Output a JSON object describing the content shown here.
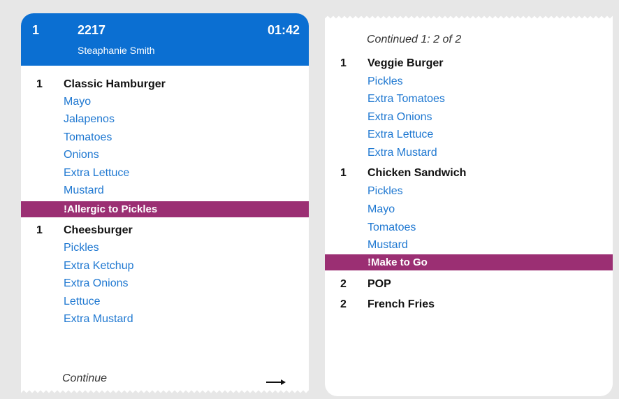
{
  "ticket_left": {
    "header": {
      "seat": "1",
      "order_number": "2217",
      "customer_name": "Steaphanie Smith",
      "timer": "01:42",
      "color": "#0b6fd2"
    },
    "items": [
      {
        "qty": "1",
        "name": "Classic Hamburger",
        "modifiers": [
          "Mayo",
          "Jalapenos",
          "Tomatoes",
          "Onions",
          "Extra Lettuce",
          "Mustard"
        ],
        "alert": "!Allergic to Pickles"
      },
      {
        "qty": "1",
        "name": "Cheesburger",
        "modifiers": [
          "Pickles",
          "Extra Ketchup",
          "Extra Onions",
          "Lettuce",
          "Extra Mustard"
        ]
      }
    ],
    "footer": {
      "label": "Continue",
      "arrow_icon": "arrow-right-icon"
    }
  },
  "ticket_right": {
    "continued_label": "Continued 1: 2 of 2",
    "items": [
      {
        "qty": "1",
        "name": "Veggie Burger",
        "modifiers": [
          "Pickles",
          "Extra Tomatoes",
          "Extra Onions",
          "Extra Lettuce",
          "Extra Mustard"
        ]
      },
      {
        "qty": "1",
        "name": "Chicken Sandwich",
        "modifiers": [
          "Pickles",
          "Mayo",
          "Tomatoes",
          "Mustard"
        ],
        "alert": "!Make to Go"
      },
      {
        "qty": "2",
        "name": "POP",
        "modifiers": []
      },
      {
        "qty": "2",
        "name": "French Fries",
        "modifiers": []
      }
    ]
  },
  "colors": {
    "modifier_text": "#1f78d1",
    "alert_bg": "#9b2f73",
    "background": "#e7e7e7"
  }
}
